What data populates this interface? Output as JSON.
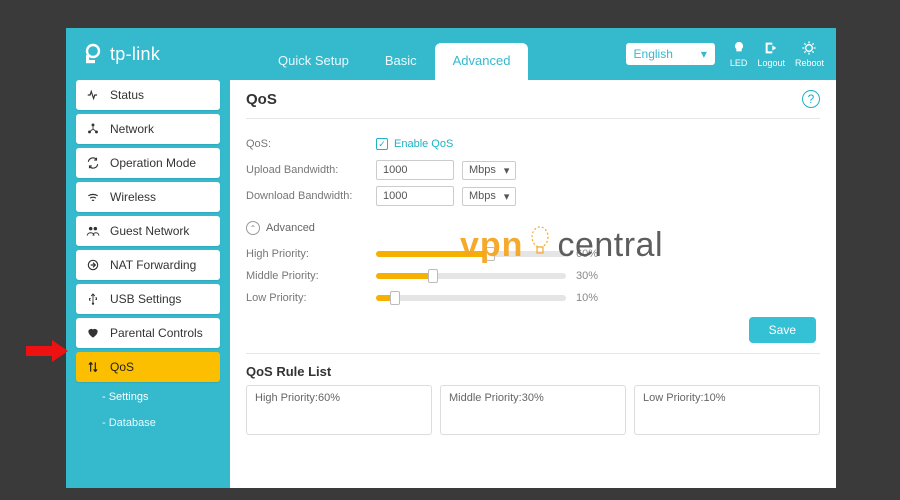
{
  "logo_text": "tp-link",
  "tabs": {
    "quick": "Quick Setup",
    "basic": "Basic",
    "advanced": "Advanced"
  },
  "language": "English",
  "header_icons": {
    "led": "LED",
    "logout": "Logout",
    "reboot": "Reboot"
  },
  "sidebar": {
    "status": "Status",
    "network": "Network",
    "op_mode": "Operation Mode",
    "wireless": "Wireless",
    "guest": "Guest Network",
    "nat": "NAT Forwarding",
    "usb": "USB Settings",
    "parental": "Parental Controls",
    "qos": "QoS",
    "sub_settings": "-  Settings",
    "sub_database": "-  Database"
  },
  "panel": {
    "title": "QoS",
    "qos_label": "QoS:",
    "enable_label": "Enable QoS",
    "upload_label": "Upload Bandwidth:",
    "download_label": "Download Bandwidth:",
    "upload_value": "1000",
    "download_value": "1000",
    "unit": "Mbps",
    "advanced_label": "Advanced",
    "high_label": "High Priority:",
    "mid_label": "Middle Priority:",
    "low_label": "Low Priority:",
    "high_pct": "60",
    "mid_pct": "30",
    "low_pct": "10",
    "high_pct_disp": "60%",
    "mid_pct_disp": "30%",
    "low_pct_disp": "10%",
    "save": "Save",
    "rule_list_title": "QoS Rule List",
    "rule_high": "High Priority:60%",
    "rule_mid": "Middle Priority:30%",
    "rule_low": "Low Priority:10%"
  },
  "watermark": {
    "vpn": "vpn",
    "central": "central"
  }
}
